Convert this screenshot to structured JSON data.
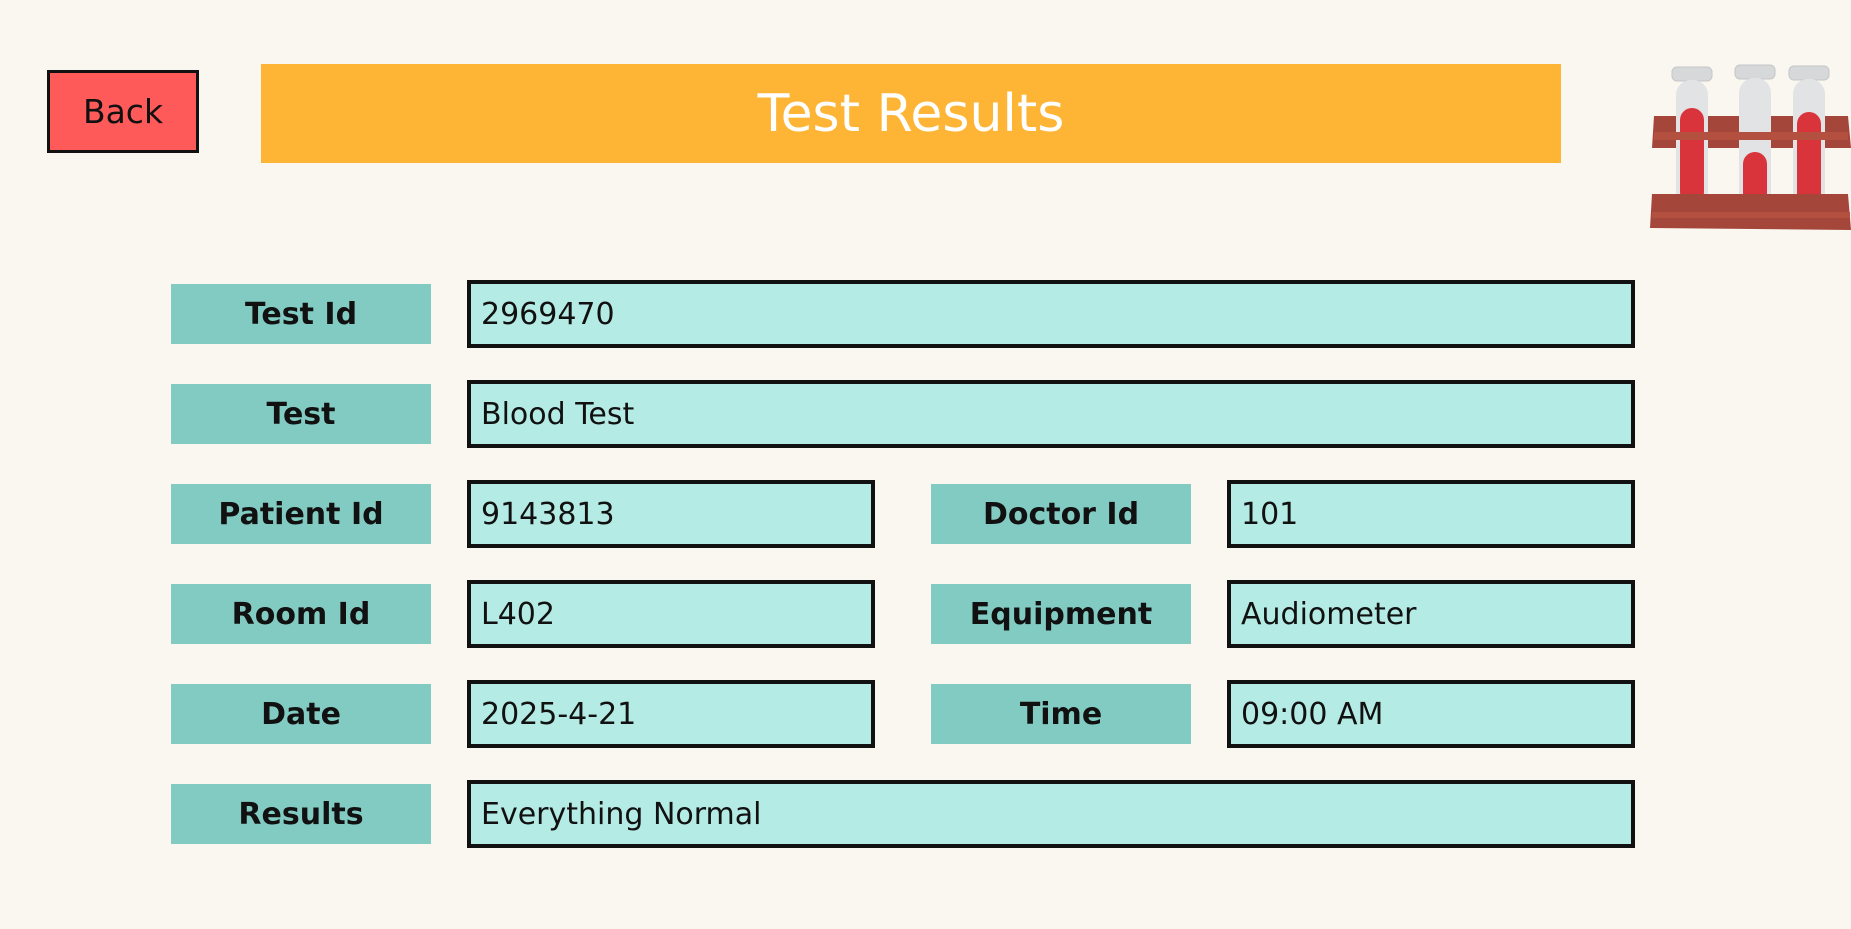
{
  "header": {
    "back_label": "Back",
    "title": "Test Results"
  },
  "icons": {
    "test_tubes": "test-tubes-icon"
  },
  "colors": {
    "background": "#faf7f0",
    "back_button": "#fe5a5a",
    "title_bar": "#feb536",
    "label_bg": "#82cbc3",
    "field_bg": "#b4ebe4"
  },
  "form": {
    "test_id": {
      "label": "Test Id",
      "value": "2969470"
    },
    "test": {
      "label": "Test",
      "value": "Blood Test"
    },
    "patient_id": {
      "label": "Patient Id",
      "value": "9143813"
    },
    "doctor_id": {
      "label": "Doctor Id",
      "value": "101"
    },
    "room_id": {
      "label": "Room Id",
      "value": "L402"
    },
    "equipment": {
      "label": "Equipment",
      "value": "Audiometer"
    },
    "date": {
      "label": "Date",
      "value": "2025-4-21"
    },
    "time": {
      "label": "Time",
      "value": "09:00 AM"
    },
    "results": {
      "label": "Results",
      "value": "Everything Normal"
    }
  }
}
